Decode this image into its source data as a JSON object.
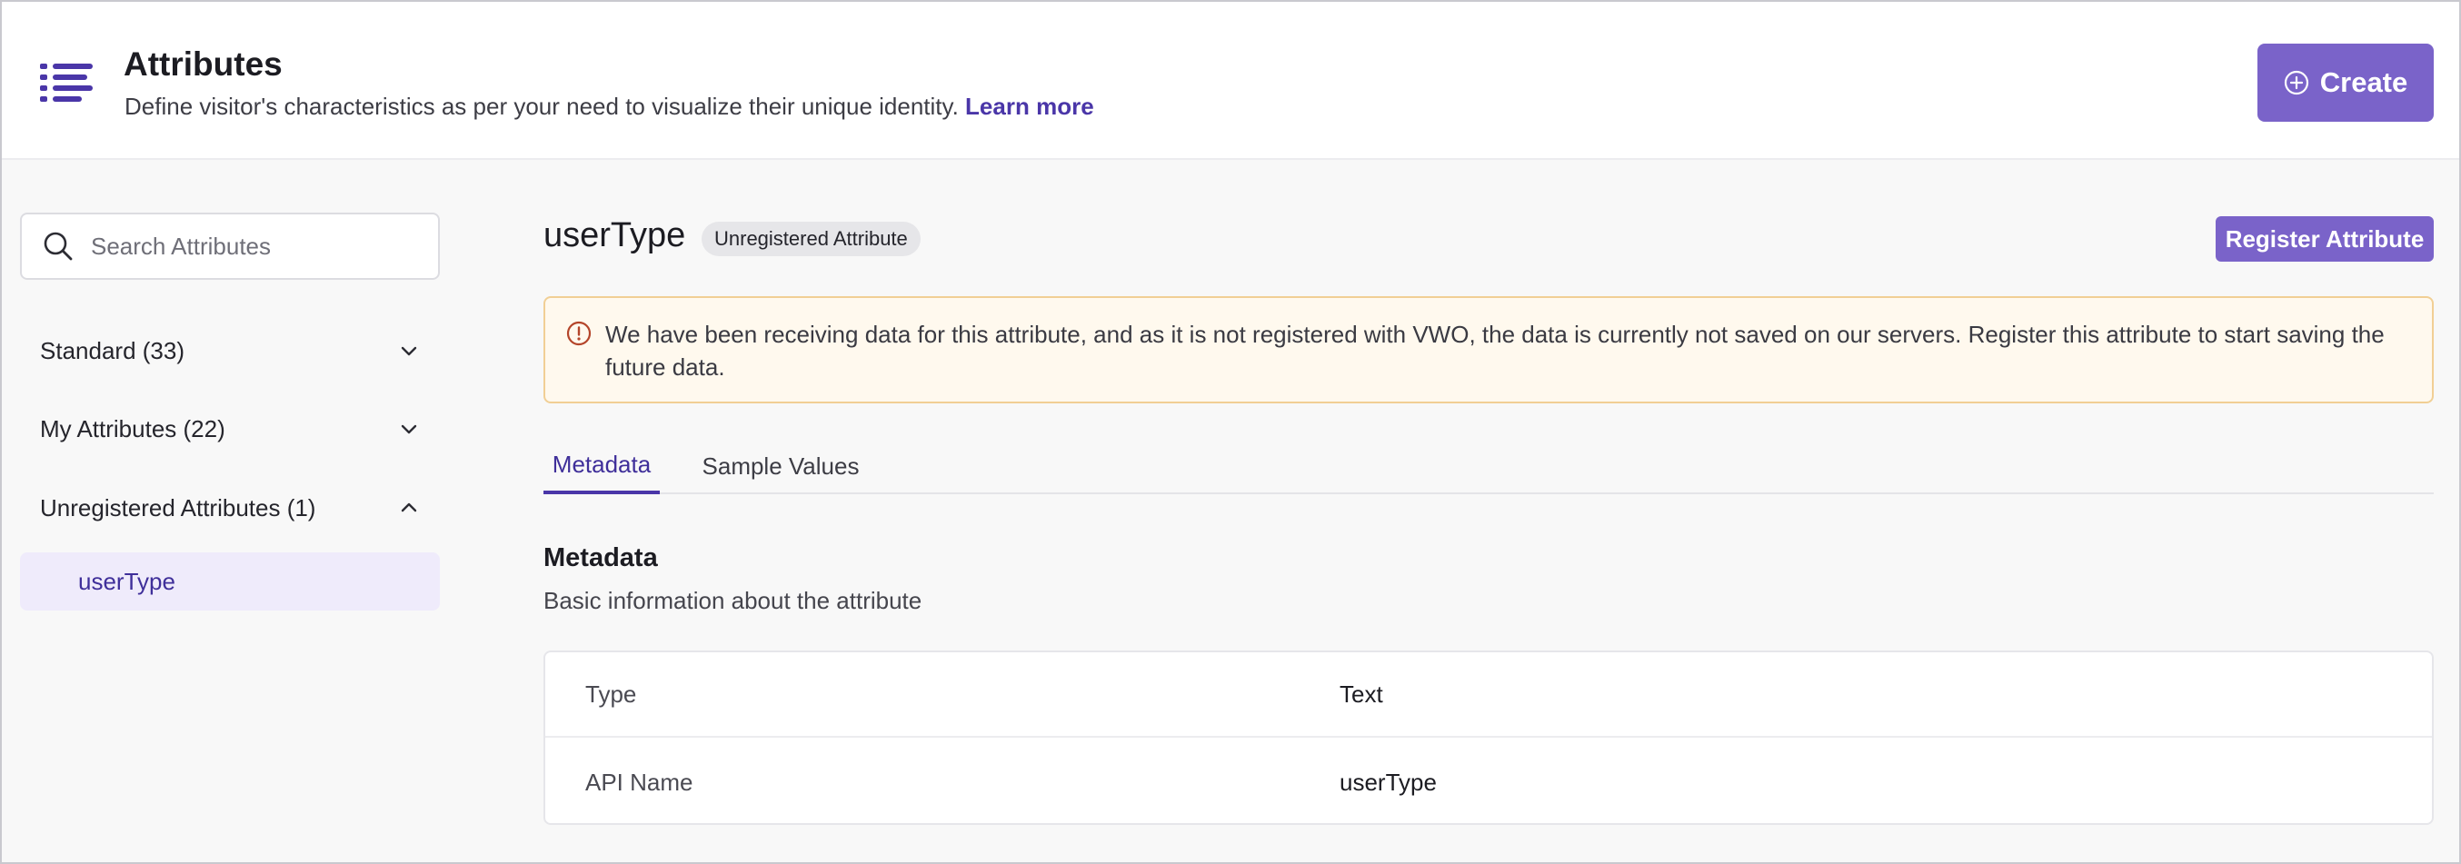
{
  "header": {
    "title": "Attributes",
    "subtitle": "Define visitor's characteristics as per your need to visualize their unique identity.",
    "learn_more": "Learn more",
    "create_label": "Create",
    "icon": "list-icon"
  },
  "sidebar": {
    "search": {
      "placeholder": "Search Attributes",
      "value": ""
    },
    "groups": [
      {
        "label": "Standard (33)",
        "expanded": false
      },
      {
        "label": "My Attributes (22)",
        "expanded": false
      },
      {
        "label": "Unregistered Attributes (1)",
        "expanded": true
      }
    ],
    "unregistered_items": [
      {
        "label": "userType",
        "selected": true
      }
    ]
  },
  "main": {
    "attribute_name": "userType",
    "badge": "Unregistered Attribute",
    "register_label": "Register Attribute",
    "alert": "We have been receiving data for this attribute, and as it is not registered with VWO, the data is currently not saved on our servers. Register this attribute to start saving the future data.",
    "tabs": [
      {
        "label": "Metadata",
        "active": true
      },
      {
        "label": "Sample Values",
        "active": false
      }
    ],
    "section": {
      "title": "Metadata",
      "subtitle": "Basic information about the attribute"
    },
    "metadata_rows": [
      {
        "key": "Type",
        "value": "Text"
      },
      {
        "key": "API Name",
        "value": "userType"
      }
    ]
  },
  "colors": {
    "primary": "#7a63c9",
    "primary_dark": "#4a36a8",
    "selected_bg": "#efebfb",
    "alert_bg": "#fff9ee",
    "alert_border": "#f1cf95",
    "alert_icon": "#b4452a"
  }
}
